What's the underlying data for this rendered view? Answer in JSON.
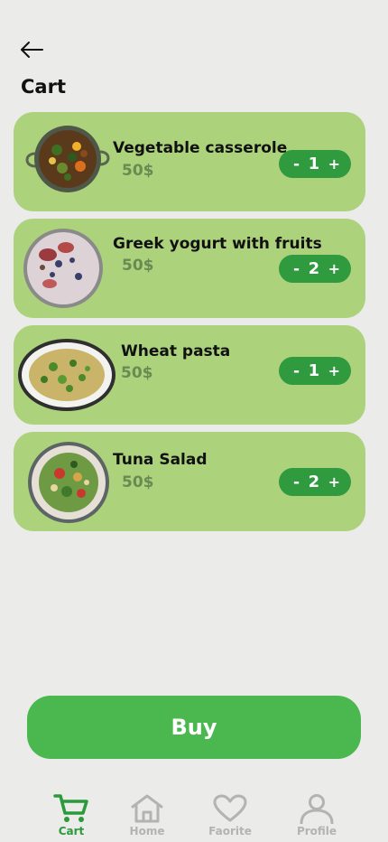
{
  "header": {
    "title": "Cart",
    "back_icon": "arrow-left-icon"
  },
  "items": [
    {
      "name": "Vegetable casserole",
      "price": "50$",
      "qty": "1",
      "minus": "-",
      "plus": "+"
    },
    {
      "name": "Greek yogurt with fruits",
      "price": "50$",
      "qty": "2",
      "minus": "-",
      "plus": "+"
    },
    {
      "name": "Wheat pasta",
      "price": "50$",
      "qty": "1",
      "minus": "-",
      "plus": "+"
    },
    {
      "name": "Tuna Salad",
      "price": "50$",
      "qty": "2",
      "minus": "-",
      "plus": "+"
    }
  ],
  "buy_label": "Buy",
  "nav": [
    {
      "label": "Cart",
      "icon": "cart-icon",
      "active": true
    },
    {
      "label": "Home",
      "icon": "home-icon",
      "active": false
    },
    {
      "label": "Faorite",
      "icon": "heart-icon",
      "active": false
    },
    {
      "label": "Profile",
      "icon": "user-icon",
      "active": false
    }
  ],
  "colors": {
    "background": "#ebebea",
    "card": "#acd37c",
    "stepper": "#2f9a3e",
    "buy_button": "#4bb84f",
    "nav_active": "#2a9a3a",
    "nav_inactive": "#b3b3b3"
  }
}
